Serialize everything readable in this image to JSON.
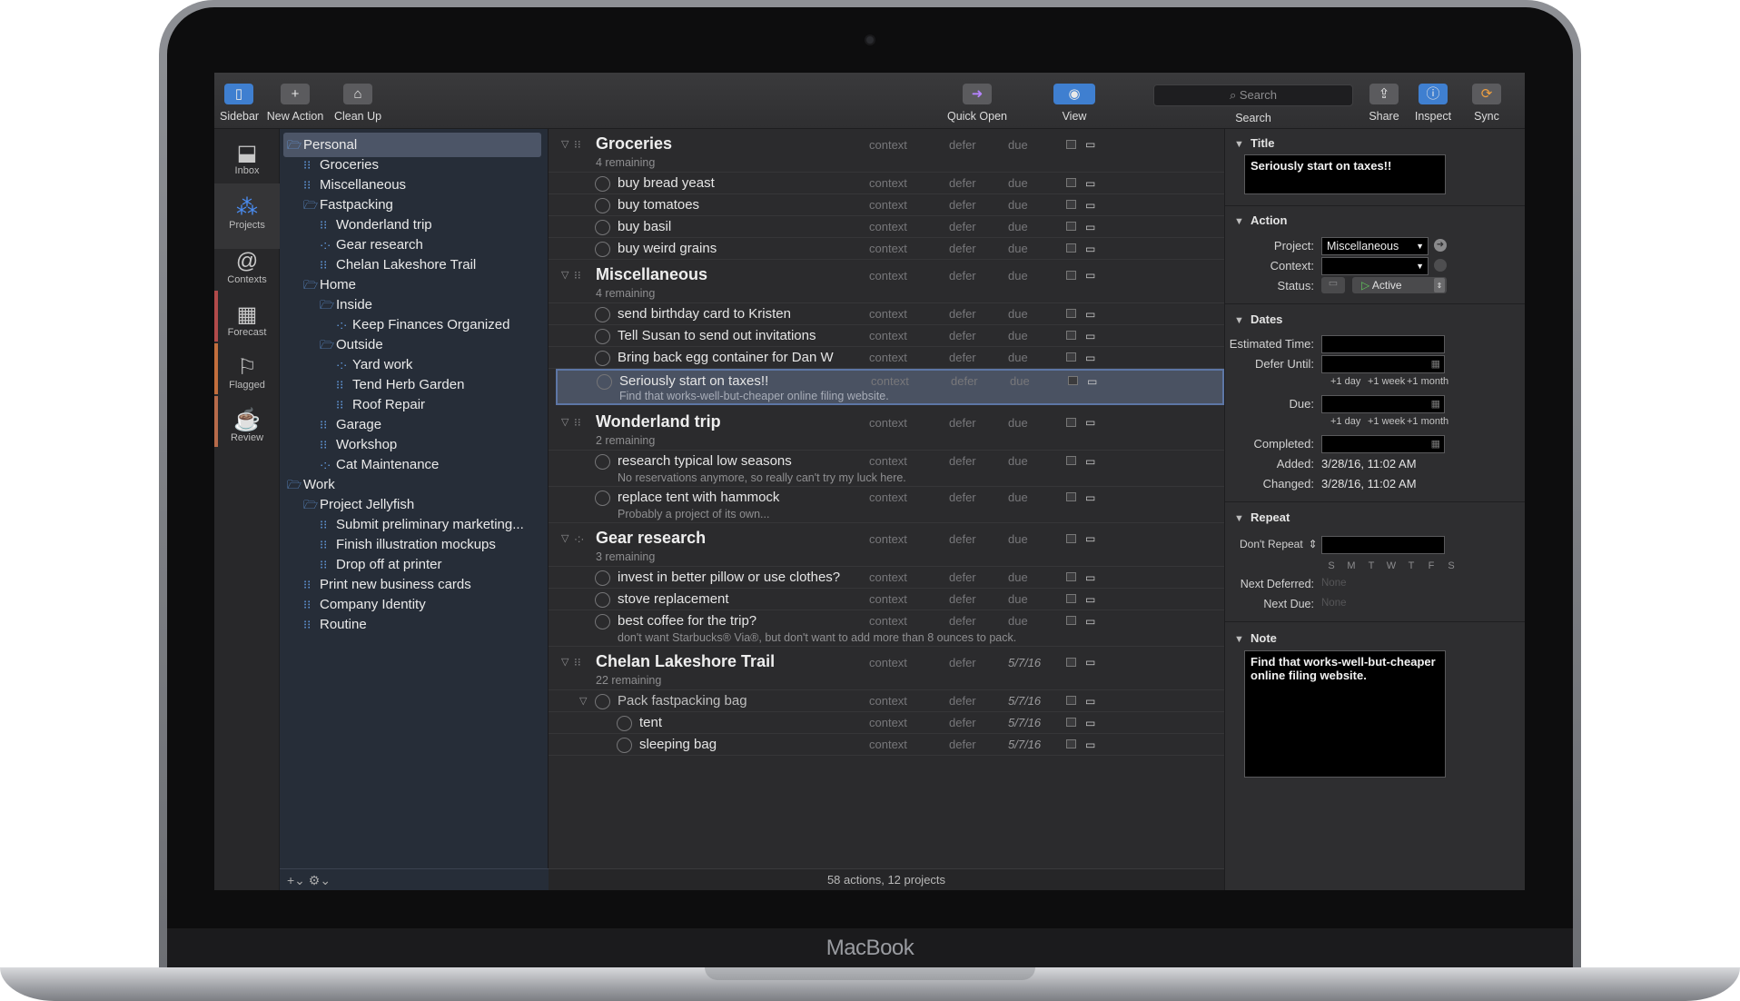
{
  "device": {
    "brand": "MacBook"
  },
  "toolbar": {
    "sidebar": "Sidebar",
    "new_action": "New Action",
    "clean_up": "Clean Up",
    "quick_open": "Quick Open",
    "view": "View",
    "search_placeholder": "Search",
    "search_label": "Search",
    "share": "Share",
    "inspect": "Inspect",
    "sync": "Sync"
  },
  "tabs": [
    "Inbox",
    "Projects",
    "Contexts",
    "Forecast",
    "Flagged",
    "Review"
  ],
  "tab_colors": {
    "forecast": "#b14a4a",
    "flagged": "#c26e3d",
    "review": "#b66a4a"
  },
  "outline": [
    "Personal",
    "Groceries",
    "Miscellaneous",
    "Fastpacking",
    "Wonderland trip",
    "Gear research",
    "Chelan Lakeshore Trail",
    "Home",
    "Inside",
    "Keep Finances Organized",
    "Outside",
    "Yard work",
    "Tend Herb Garden",
    "Roof Repair",
    "Garage",
    "Workshop",
    "Cat Maintenance",
    "Work",
    "Project Jellyfish",
    "Submit preliminary marketing...",
    "Finish illustration mockups",
    "Drop off at printer",
    "Print new business cards",
    "Company Identity",
    "Routine"
  ],
  "outline_footer": "+⌄   ⚙⌄",
  "columns": {
    "context": "context",
    "defer": "defer",
    "due": "due"
  },
  "projects": [
    {
      "title": "Groceries",
      "sub": "4 remaining",
      "due": "due"
    },
    {
      "title": "Miscellaneous",
      "sub": "4 remaining",
      "due": "due"
    },
    {
      "title": "Wonderland trip",
      "sub": "2 remaining",
      "due": "due"
    },
    {
      "title": "Gear research",
      "sub": "3 remaining",
      "due": "due"
    },
    {
      "title": "Chelan Lakeshore Trail",
      "sub": "22 remaining",
      "due": "5/7/16"
    }
  ],
  "actions": [
    {
      "title": "buy bread yeast",
      "note": "",
      "due": "due"
    },
    {
      "title": "buy tomatoes",
      "note": "",
      "due": "due"
    },
    {
      "title": "buy basil",
      "note": "",
      "due": "due"
    },
    {
      "title": "buy weird grains",
      "note": "",
      "due": "due"
    },
    {
      "title": "send birthday card to Kristen",
      "note": "",
      "due": "due"
    },
    {
      "title": "Tell Susan to send out invitations",
      "note": "",
      "due": "due"
    },
    {
      "title": "Bring back egg container for Dan W",
      "note": "",
      "due": "due"
    },
    {
      "title": "Seriously start on taxes!!",
      "note": "Find that works-well-but-cheaper online filing website.",
      "due": "due"
    },
    {
      "title": "research typical low seasons",
      "note": "No reservations anymore, so really can't try my luck here.",
      "due": "due"
    },
    {
      "title": "replace tent with hammock",
      "note": "Probably a project of its own...",
      "due": "due"
    },
    {
      "title": "invest in better pillow or use clothes?",
      "note": "",
      "due": "due"
    },
    {
      "title": "stove replacement",
      "note": "",
      "due": "due"
    },
    {
      "title": "best coffee for the trip?",
      "note": "don't want Starbucks® Via®, but don't want to add more than 8 ounces to pack.",
      "due": "due"
    },
    {
      "title": "Pack fastpacking bag",
      "note": "",
      "due": "5/7/16"
    },
    {
      "title": "tent",
      "note": "",
      "due": "5/7/16"
    },
    {
      "title": "sleeping bag",
      "note": "",
      "due": "5/7/16"
    }
  ],
  "main_footer": "58 actions, 12 projects",
  "inspector": {
    "title_header": "Title",
    "title_value": "Seriously start on taxes!!",
    "action_header": "Action",
    "project_label": "Project:",
    "project_value": "Miscellaneous",
    "context_label": "Context:",
    "context_value": "",
    "status_label": "Status:",
    "status_value": "Active",
    "dates_header": "Dates",
    "estimated_label": "Estimated Time:",
    "defer_label": "Defer Until:",
    "due_label": "Due:",
    "plus_day": "+1 day",
    "plus_week": "+1 week",
    "plus_month": "+1 month",
    "completed_label": "Completed:",
    "added_label": "Added:",
    "added_value": "3/28/16, 11:02 AM",
    "changed_label": "Changed:",
    "changed_value": "3/28/16, 11:02 AM",
    "repeat_header": "Repeat",
    "repeat_value": "Don't Repeat",
    "weekdays": [
      "S",
      "M",
      "T",
      "W",
      "T",
      "F",
      "S"
    ],
    "next_deferred_label": "Next Deferred:",
    "next_deferred_value": "None",
    "next_due_label": "Next Due:",
    "next_due_value": "None",
    "note_header": "Note",
    "note_value": "Find that works-well-but-cheaper online filing website."
  }
}
